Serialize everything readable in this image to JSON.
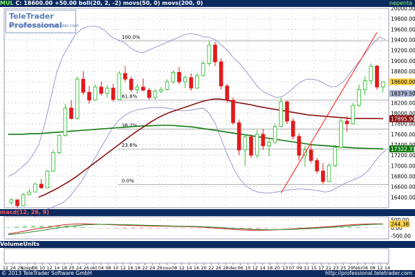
{
  "header": {
    "symbol": "MUL",
    "text": " C: 18600.00 +50.00 boll(20, 2, -2) movs(50, 0) movs(200, 0)",
    "right_label": "nepenta"
  },
  "logo": {
    "title": "TeleTrader Professional",
    "url": "http://professional.teletrader.com"
  },
  "macd": {
    "label": "macd(12, 26, 9)"
  },
  "volume": {
    "label": "VolumeUnits"
  },
  "footer": {
    "copyright": "© 2013 TeleTrader Software GmbH",
    "url": "http://professional.teletrader.com"
  },
  "colors": {
    "up": "#2fbf2f",
    "down": "#e01b1b",
    "bollinger": "#8f8fc8",
    "ma50": "#8b1010",
    "ma200": "#0f7a0f",
    "trendline": "#ff3333",
    "panel_bg": "#0b2a5e",
    "grid": "#b9b9c8"
  },
  "chart_data": [
    {
      "type": "candlestick",
      "title": "MUL",
      "x_tick_labels": [
        "12",
        "24",
        "28",
        "szept",
        "06",
        "10",
        "12",
        "14",
        "18",
        "20",
        "24",
        "26",
        "okt",
        "04",
        "08",
        "10",
        "12",
        "16",
        "18",
        "22",
        "24",
        "26",
        "nov",
        "08",
        "12",
        "14",
        "16",
        "20",
        "22",
        "26",
        "28",
        "dec",
        "06",
        "10",
        "12",
        "14",
        "18",
        "20",
        "'13",
        "07",
        "09",
        "11",
        "15",
        "17",
        "21",
        "23",
        "25",
        "29",
        "febr",
        "06",
        "08",
        "12",
        "14"
      ],
      "y_axis": {
        "min": 16200,
        "max": 20000,
        "tick_labels": [
          "20000.00",
          "19800.00",
          "19600.00",
          "19400.00",
          "19200.00",
          "19000.00",
          "18800.00",
          "18600.00",
          "18400.00",
          "18200.00",
          "18000.00",
          "17800.00",
          "17600.00",
          "17400.00",
          "17200.00",
          "17000.00",
          "16800.00",
          "16600.00",
          "16400.00"
        ],
        "ticks": [
          20000,
          19800,
          19600,
          19400,
          19200,
          19000,
          18800,
          18600,
          18400,
          18200,
          18000,
          17800,
          17600,
          17400,
          17200,
          17000,
          16800,
          16600,
          16400
        ]
      },
      "last_value_labels": [
        {
          "text": "18600.00",
          "value": 18600,
          "color": "#ffd24a"
        },
        {
          "text": "18379.50",
          "value": 18379.5,
          "color": "#aab4d8"
        },
        {
          "text": "17895.90",
          "value": 17895.9,
          "color": "#8b1010"
        },
        {
          "text": "17322.33",
          "value": 17322.33,
          "color": "#0f7a0f"
        }
      ],
      "fibonacci": [
        {
          "label": "100.0%",
          "value": 19380
        },
        {
          "label": "61.8%",
          "value": 18250
        },
        {
          "label": "38.2%",
          "value": 17700
        },
        {
          "label": "23.6%",
          "value": 17320
        },
        {
          "label": "0.0%",
          "value": 16640
        }
      ],
      "trendline": {
        "from": [
          45,
          16480
        ],
        "to": [
          61,
          19540
        ]
      },
      "candles": [
        [
          16300,
          16380,
          16260,
          16350
        ],
        [
          16350,
          16360,
          16200,
          16240
        ],
        [
          16240,
          16480,
          16230,
          16450
        ],
        [
          16450,
          16560,
          16440,
          16500
        ],
        [
          16500,
          16680,
          16500,
          16650
        ],
        [
          16650,
          16750,
          16560,
          16580
        ],
        [
          16580,
          16920,
          16580,
          16900
        ],
        [
          16900,
          17300,
          16880,
          17250
        ],
        [
          17250,
          17600,
          17220,
          17580
        ],
        [
          17580,
          18180,
          17560,
          18100
        ],
        [
          18100,
          18250,
          17880,
          17900
        ],
        [
          17900,
          18700,
          17880,
          18650
        ],
        [
          18650,
          18800,
          18350,
          18400
        ],
        [
          18400,
          18520,
          18180,
          18250
        ],
        [
          18250,
          18550,
          18240,
          18500
        ],
        [
          18500,
          18600,
          18340,
          18380
        ],
        [
          18380,
          18540,
          18300,
          18480
        ],
        [
          18480,
          18560,
          18220,
          18260
        ],
        [
          18260,
          18800,
          18250,
          18760
        ],
        [
          18760,
          18900,
          18600,
          18650
        ],
        [
          18650,
          18700,
          18400,
          18450
        ],
        [
          18450,
          18550,
          18380,
          18500
        ],
        [
          18500,
          18660,
          18420,
          18440
        ],
        [
          18440,
          18480,
          18260,
          18300
        ],
        [
          18300,
          18460,
          18260,
          18420
        ],
        [
          18420,
          18500,
          18380,
          18450
        ],
        [
          18450,
          18650,
          18430,
          18600
        ],
        [
          18600,
          18820,
          18560,
          18780
        ],
        [
          18780,
          18880,
          18550,
          18600
        ],
        [
          18600,
          18720,
          18480,
          18680
        ],
        [
          18680,
          18760,
          18430,
          18480
        ],
        [
          18480,
          18760,
          18470,
          18720
        ],
        [
          18720,
          19000,
          18700,
          18950
        ],
        [
          18950,
          19380,
          18900,
          19300
        ],
        [
          19300,
          19360,
          18900,
          18980
        ],
        [
          18980,
          19050,
          18450,
          18520
        ],
        [
          18520,
          18560,
          18200,
          18250
        ],
        [
          18250,
          18300,
          17780,
          17820
        ],
        [
          17820,
          17880,
          17200,
          17300
        ],
        [
          17300,
          17600,
          17000,
          17550
        ],
        [
          17550,
          17600,
          17150,
          17200
        ],
        [
          17200,
          17680,
          17150,
          17600
        ],
        [
          17600,
          17700,
          17300,
          17380
        ],
        [
          17380,
          17500,
          17180,
          17450
        ],
        [
          17450,
          17800,
          17420,
          17750
        ],
        [
          17750,
          18300,
          17740,
          18220
        ],
        [
          18220,
          18240,
          17800,
          17850
        ],
        [
          17850,
          17900,
          17500,
          17560
        ],
        [
          17560,
          17620,
          17100,
          17200
        ],
        [
          17200,
          17380,
          16980,
          17300
        ],
        [
          17300,
          17400,
          17050,
          17100
        ],
        [
          17100,
          17150,
          16850,
          16900
        ],
        [
          16900,
          17050,
          16650,
          16700
        ],
        [
          16700,
          17050,
          16690,
          17000
        ],
        [
          17000,
          17400,
          16980,
          17350
        ],
        [
          17350,
          17900,
          17340,
          17850
        ],
        [
          17850,
          17950,
          17650,
          17800
        ],
        [
          17800,
          18200,
          17780,
          18150
        ],
        [
          18150,
          18550,
          18120,
          18450
        ],
        [
          18450,
          18700,
          18350,
          18620
        ],
        [
          18620,
          18950,
          18550,
          18900
        ],
        [
          18900,
          18920,
          18450,
          18500
        ],
        [
          18500,
          18600,
          18400,
          18600
        ]
      ],
      "bollinger_upper": [
        16800,
        16850,
        16950,
        17050,
        17200,
        17400,
        17800,
        18300,
        18800,
        19100,
        19300,
        19500,
        19600,
        19650,
        19660,
        19640,
        19560,
        19450,
        19400,
        19350,
        19250,
        19180,
        19150,
        19200,
        19250,
        19300,
        19350,
        19400,
        19450,
        19500,
        19520,
        19500,
        19460,
        19450,
        19400,
        19300,
        19200,
        19050,
        18950,
        18800,
        18650,
        18500,
        18400,
        18350,
        18300,
        18320,
        18400,
        18500,
        18600,
        18650,
        18650,
        18620,
        18560,
        18500,
        18520,
        18600,
        18750,
        18900,
        19050,
        19200,
        19350,
        19450,
        19400
      ],
      "bollinger_lower": [
        15600,
        15700,
        15800,
        15900,
        16000,
        16100,
        16150,
        16200,
        16250,
        16300,
        16400,
        16550,
        16700,
        16900,
        17100,
        17300,
        17500,
        17700,
        17850,
        17950,
        18020,
        18060,
        18080,
        18100,
        18110,
        18110,
        18100,
        18080,
        18050,
        18050,
        18060,
        18080,
        18100,
        18000,
        17800,
        17500,
        17200,
        16950,
        16750,
        16620,
        16540,
        16500,
        16480,
        16480,
        16500,
        16520,
        16540,
        16550,
        16560,
        16550,
        16540,
        16520,
        16500,
        16520,
        16580,
        16650,
        16700,
        16750,
        16800,
        16900,
        17050,
        17200,
        17300
      ],
      "ma50": [
        16400,
        16450,
        16510,
        16570,
        16640,
        16710,
        16790,
        16880,
        16970,
        17060,
        17150,
        17240,
        17330,
        17420,
        17510,
        17600,
        17680,
        17760,
        17840,
        17910,
        17970,
        18020,
        18060,
        18100,
        18140,
        18180,
        18220,
        18250,
        18270,
        18270,
        18250,
        18220,
        18200,
        18180,
        18160,
        18130,
        18110,
        18090,
        18070,
        18050,
        18030,
        18010,
        17990,
        17970,
        17960,
        17950,
        17940,
        17930,
        17920,
        17910,
        17900,
        17900,
        17900,
        17900,
        17900,
        17895.9
      ],
      "ma200": [
        17600,
        17600,
        17600,
        17610,
        17610,
        17620,
        17630,
        17640,
        17650,
        17660,
        17670,
        17680,
        17690,
        17700,
        17710,
        17720,
        17730,
        17740,
        17750,
        17760,
        17760,
        17770,
        17770,
        17770,
        17760,
        17750,
        17740,
        17720,
        17700,
        17680,
        17660,
        17640,
        17620,
        17600,
        17580,
        17560,
        17540,
        17520,
        17500,
        17480,
        17460,
        17440,
        17420,
        17400,
        17390,
        17380,
        17370,
        17360,
        17350,
        17340,
        17335,
        17330,
        17326,
        17322.33
      ]
    },
    {
      "type": "line",
      "title": "macd(12, 26, 9)",
      "y_axis": {
        "tick_labels": [
          "500.00",
          "0.00",
          "-500.00"
        ],
        "ticks": [
          500,
          0,
          -500
        ],
        "min": -700,
        "max": 700
      },
      "last_value_label": {
        "text": "244.38",
        "value": 244.38
      },
      "series": [
        {
          "name": "macd",
          "values": [
            -380,
            -300,
            -200,
            -100,
            -20,
            60,
            150,
            210,
            240,
            250,
            240,
            220,
            200,
            180,
            160,
            140,
            130,
            120,
            110,
            100,
            90,
            80,
            70,
            50,
            20,
            -20,
            -60,
            -100,
            -130,
            -150,
            -160,
            -150,
            -130,
            -100,
            -70,
            -40,
            -10,
            20,
            60,
            100,
            150,
            190,
            220,
            240,
            250,
            244
          ]
        },
        {
          "name": "signal",
          "values": [
            -420,
            -380,
            -320,
            -240,
            -160,
            -80,
            0,
            70,
            130,
            180,
            210,
            220,
            220,
            210,
            200,
            185,
            170,
            155,
            140,
            125,
            110,
            100,
            90,
            75,
            55,
            30,
            0,
            -30,
            -60,
            -90,
            -110,
            -120,
            -120,
            -110,
            -95,
            -75,
            -50,
            -20,
            10,
            45,
            85,
            125,
            165,
            200,
            225,
            235
          ]
        }
      ]
    },
    {
      "type": "bar",
      "title": "VolumeUnits",
      "values": []
    }
  ]
}
